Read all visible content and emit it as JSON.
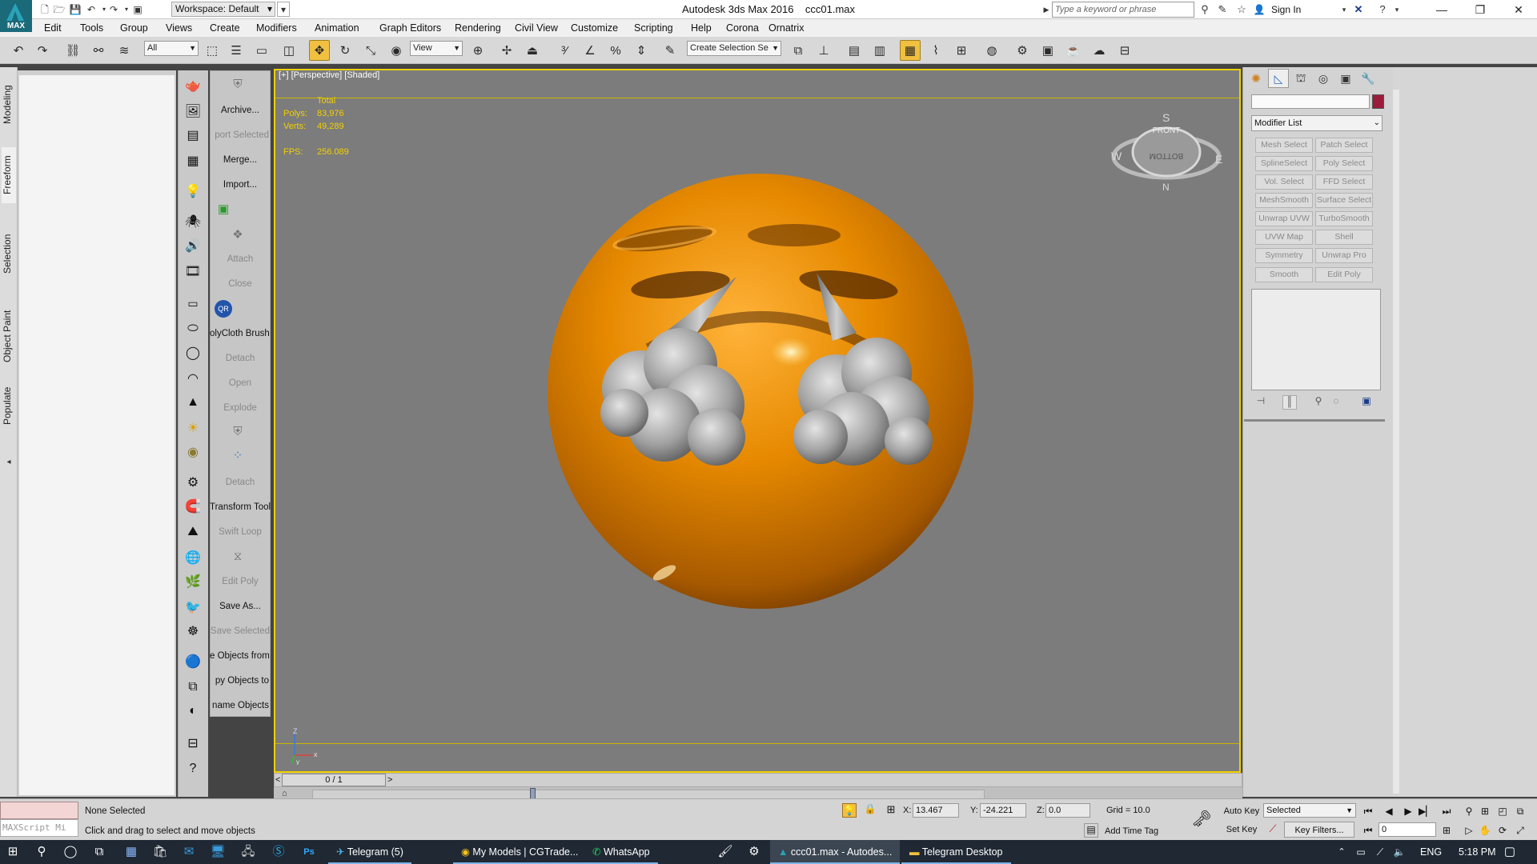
{
  "app": {
    "title": "Autodesk 3ds Max 2016",
    "file": "ccc01.max",
    "logo_text": "MAX",
    "workspace": "Workspace: Default",
    "search_placeholder": "Type a keyword or phrase",
    "sign_in": "Sign In"
  },
  "menus": [
    "Edit",
    "Tools",
    "Group",
    "Views",
    "Create",
    "Modifiers",
    "Animation",
    "Graph Editors",
    "Rendering",
    "Civil View",
    "Customize",
    "Scripting",
    "Help",
    "Corona",
    "Ornatrix"
  ],
  "toolbar": {
    "filter_value": "All",
    "coord_value": "View",
    "selection_set_placeholder": "Create Selection Se"
  },
  "ribbon_tabs": [
    "Modeling",
    "Freeform",
    "Selection",
    "Object Paint",
    "Populate"
  ],
  "side_panel": {
    "labels": [
      {
        "text": "Archive...",
        "dim": false,
        "clip": false
      },
      {
        "text": "port Selected",
        "dim": true,
        "clip": true
      },
      {
        "text": "Merge...",
        "dim": false,
        "clip": false
      },
      {
        "text": "Import...",
        "dim": false,
        "clip": false
      },
      {
        "text": "Attach",
        "dim": true,
        "clip": false
      },
      {
        "text": "Close",
        "dim": true,
        "clip": false
      },
      {
        "text": "olyCloth Brush",
        "dim": false,
        "clip": true
      },
      {
        "text": "Detach",
        "dim": true,
        "clip": false
      },
      {
        "text": "Open",
        "dim": true,
        "clip": false
      },
      {
        "text": "Explode",
        "dim": true,
        "clip": false
      },
      {
        "text": "Detach",
        "dim": true,
        "clip": false
      },
      {
        "text": "Transform Tool",
        "dim": false,
        "clip": true
      },
      {
        "text": "Swift Loop",
        "dim": true,
        "clip": false
      },
      {
        "text": "Edit Poly",
        "dim": true,
        "clip": false
      },
      {
        "text": "Save As...",
        "dim": false,
        "clip": false
      },
      {
        "text": "Save Selected",
        "dim": true,
        "clip": false
      },
      {
        "text": "e Objects from",
        "dim": false,
        "clip": true
      },
      {
        "text": "py Objects to",
        "dim": false,
        "clip": true
      },
      {
        "text": "name Objects",
        "dim": false,
        "clip": true
      }
    ],
    "badge_text": "QR"
  },
  "viewport": {
    "label_plus": "[+]",
    "label_view": "[Perspective]",
    "label_shade": "[Shaded]",
    "stats": {
      "header": "Total",
      "polys_label": "Polys:",
      "polys_value": "83,976",
      "verts_label": "Verts:",
      "verts_value": "49,289",
      "fps_label": "FPS:",
      "fps_value": "256.089"
    },
    "viewcube": {
      "front": "FRONT",
      "bottom": "BOTTOM",
      "w": "W",
      "e": "E",
      "s": "S",
      "n": "N"
    },
    "axis": {
      "z": "Z",
      "x": "x",
      "y": "y"
    },
    "colors": {
      "border": "#f0d000",
      "background": "#7c7c7c",
      "emoji": "#e08a00"
    }
  },
  "time_slider": {
    "value": "0 / 1",
    "prev": "<",
    "next": ">"
  },
  "command_panel": {
    "modifier_list": "Modifier List",
    "modifier_buttons": [
      "Mesh Select",
      "Patch Select",
      "SplineSelect",
      "Poly Select",
      "Vol. Select",
      "FFD Select",
      "MeshSmooth",
      "Surface Select",
      "Unwrap UVW",
      "TurboSmooth",
      "UVW Map",
      "Shell",
      "Symmetry",
      "Unwrap Pro",
      "Smooth",
      "Edit Poly"
    ],
    "object_color": "#9b1c3a"
  },
  "status": {
    "maxscript": "MAXScript Mi",
    "selection": "None Selected",
    "prompt": "Click and drag to select and move objects",
    "x_label": "X:",
    "x_value": "13.467",
    "y_label": "Y:",
    "y_value": "-24.221",
    "z_label": "Z:",
    "z_value": "0.0",
    "grid": "Grid = 10.0",
    "add_time_tag": "Add Time Tag",
    "auto_key": "Auto Key",
    "set_key": "Set Key",
    "selected": "Selected",
    "key_filters": "Key Filters...",
    "frame": "0"
  },
  "taskbar": {
    "items": [
      "Telegram (5)",
      "My Models | CGTrade...",
      "WhatsApp",
      "ccc01.max - Autodes...",
      "Telegram Desktop"
    ],
    "language": "ENG",
    "time": "5:18 PM"
  }
}
